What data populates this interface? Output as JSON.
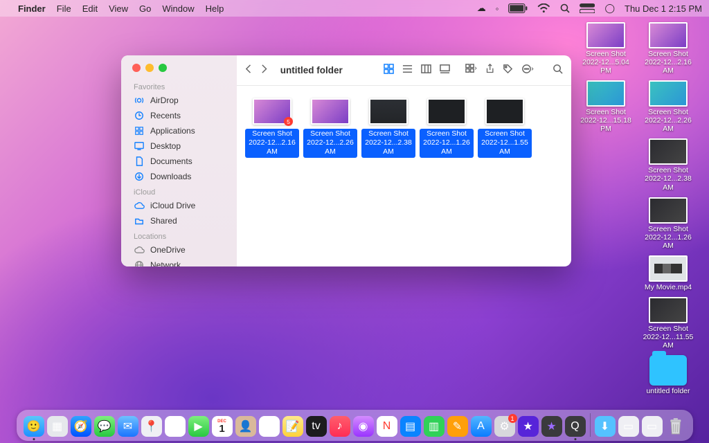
{
  "menubar": {
    "app": "Finder",
    "items": [
      "File",
      "Edit",
      "View",
      "Go",
      "Window",
      "Help"
    ],
    "datetime": "Thu Dec 1  2:15 PM"
  },
  "desktop": {
    "col1": [
      {
        "line1": "Screen Shot",
        "line2": "2022-12...5.04 PM",
        "variant": ""
      },
      {
        "line1": "Screen Shot",
        "line2": "2022-12...15.18 PM",
        "variant": "teal"
      }
    ],
    "col2": [
      {
        "line1": "Screen Shot",
        "line2": "2022-12...2.16 AM",
        "variant": ""
      },
      {
        "line1": "Screen Shot",
        "line2": "2022-12...2.26 AM",
        "variant": "teal"
      },
      {
        "line1": "Screen Shot",
        "line2": "2022-12...2.38 AM",
        "variant": "dark"
      },
      {
        "line1": "Screen Shot",
        "line2": "2022-12...1.26 AM",
        "variant": "dark"
      },
      {
        "line1": "My Movie.mp4",
        "line2": "",
        "variant": "movie"
      },
      {
        "line1": "Screen Shot",
        "line2": "2022-12...11.55 AM",
        "variant": "dark"
      },
      {
        "line1": "untitled folder",
        "line2": "",
        "variant": "folder"
      }
    ]
  },
  "finder": {
    "title": "untitled folder",
    "sidebar": {
      "sections": [
        {
          "label": "Favorites",
          "items": [
            {
              "icon": "airdrop",
              "label": "AirDrop"
            },
            {
              "icon": "recents",
              "label": "Recents"
            },
            {
              "icon": "apps",
              "label": "Applications"
            },
            {
              "icon": "desktop",
              "label": "Desktop"
            },
            {
              "icon": "docs",
              "label": "Documents"
            },
            {
              "icon": "downloads",
              "label": "Downloads"
            }
          ]
        },
        {
          "label": "iCloud",
          "items": [
            {
              "icon": "icloud",
              "label": "iCloud Drive"
            },
            {
              "icon": "shared",
              "label": "Shared"
            }
          ]
        },
        {
          "label": "Locations",
          "gray": true,
          "items": [
            {
              "icon": "onedrive",
              "label": "OneDrive"
            },
            {
              "icon": "network",
              "label": "Network"
            }
          ]
        }
      ]
    },
    "files": [
      {
        "line1": "Screen Shot",
        "line2": "2022-12...2.16 AM",
        "variant": "",
        "badge": "5"
      },
      {
        "line1": "Screen Shot",
        "line2": "2022-12...2.26 AM",
        "variant": "",
        "badge": ""
      },
      {
        "line1": "Screen Shot",
        "line2": "2022-12...2.38 AM",
        "variant": "dark",
        "badge": ""
      },
      {
        "line1": "Screen Shot",
        "line2": "2022-12...1.26 AM",
        "variant": "darker",
        "badge": ""
      },
      {
        "line1": "Screen Shot",
        "line2": "2022-12...1.55 AM",
        "variant": "darker",
        "badge": ""
      }
    ]
  },
  "dock": {
    "apps": [
      {
        "name": "finder",
        "bg": "linear-gradient(#5ac8fa,#1e90ff)",
        "glyph": "🙂",
        "running": true
      },
      {
        "name": "launchpad",
        "bg": "#e6e8ec",
        "glyph": "▦"
      },
      {
        "name": "safari",
        "bg": "linear-gradient(#2fa4ff,#0051ff)",
        "glyph": "🧭"
      },
      {
        "name": "messages",
        "bg": "linear-gradient(#7ef07e,#28c840)",
        "glyph": "💬"
      },
      {
        "name": "mail",
        "bg": "linear-gradient(#6ec1ff,#1b74ff)",
        "glyph": "✉︎"
      },
      {
        "name": "maps",
        "bg": "#efeff4",
        "glyph": "📍"
      },
      {
        "name": "photos",
        "bg": "#fff",
        "glyph": "✿"
      },
      {
        "name": "facetime",
        "bg": "linear-gradient(#7ef07e,#28c840)",
        "glyph": "▶"
      },
      {
        "name": "calendar",
        "bg": "#fff",
        "glyph": "1",
        "text": "#d33",
        "sub": "DEC"
      },
      {
        "name": "contacts",
        "bg": "#d9b99b",
        "glyph": "👤"
      },
      {
        "name": "reminders",
        "bg": "#fff",
        "glyph": "☰"
      },
      {
        "name": "notes",
        "bg": "linear-gradient(#ffe98a,#ffd23a)",
        "glyph": "📝"
      },
      {
        "name": "tv",
        "bg": "#1c1c1e",
        "glyph": "tv"
      },
      {
        "name": "music",
        "bg": "linear-gradient(#ff5e6c,#ff2d55)",
        "glyph": "♪"
      },
      {
        "name": "podcasts",
        "bg": "linear-gradient(#d48bff,#9a34ff)",
        "glyph": "◉"
      },
      {
        "name": "news",
        "bg": "#fff",
        "glyph": "N",
        "text": "#ff3b30"
      },
      {
        "name": "keynote",
        "bg": "#0a84ff",
        "glyph": "▤"
      },
      {
        "name": "numbers",
        "bg": "#30d158",
        "glyph": "▥"
      },
      {
        "name": "pages",
        "bg": "#ff9f0a",
        "glyph": "✎"
      },
      {
        "name": "appstore",
        "bg": "linear-gradient(#53b7ff,#0a7bff)",
        "glyph": "A"
      },
      {
        "name": "settings",
        "bg": "#d7d7dc",
        "glyph": "⚙︎",
        "notif": "1"
      },
      {
        "name": "clips",
        "bg": "#5724d9",
        "glyph": "★"
      },
      {
        "name": "imovie",
        "bg": "#3a3a3c",
        "glyph": "★",
        "text": "#9a6bff"
      },
      {
        "name": "quicktime",
        "bg": "#3a3a3c",
        "glyph": "Q",
        "running": true
      }
    ],
    "right": [
      {
        "name": "downloads",
        "bg": "#55c2ff",
        "glyph": "⬇︎"
      },
      {
        "name": "recent1",
        "bg": "#efeff4",
        "glyph": "▭"
      },
      {
        "name": "recent2",
        "bg": "#efeff4",
        "glyph": "▭"
      }
    ]
  }
}
